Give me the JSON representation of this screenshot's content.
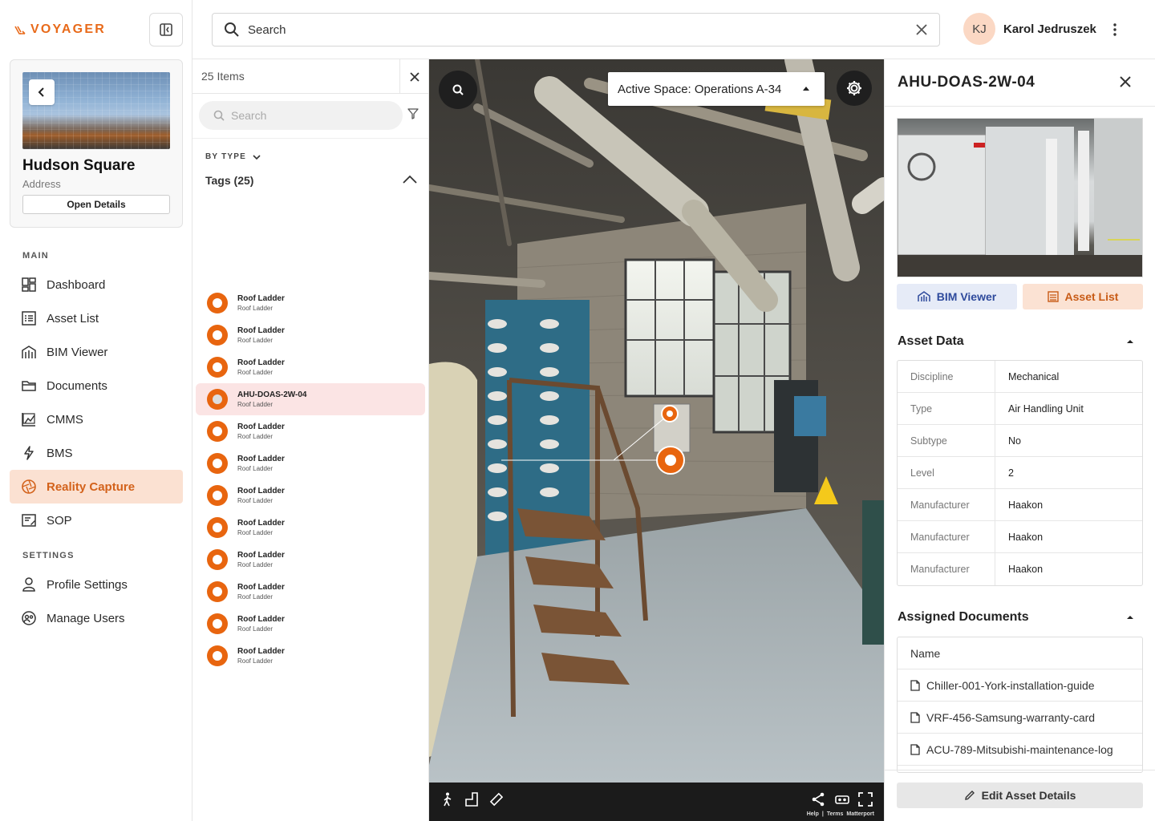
{
  "brand": {
    "name": "VOYAGER",
    "accent": "#e86a1a"
  },
  "property": {
    "name": "Hudson Square",
    "address": "Address",
    "open_details": "Open Details"
  },
  "nav": {
    "main_label": "MAIN",
    "settings_label": "SETTINGS",
    "items": [
      {
        "label": "Dashboard",
        "icon": "dashboard-icon"
      },
      {
        "label": "Asset List",
        "icon": "list-icon"
      },
      {
        "label": "BIM Viewer",
        "icon": "building-icon"
      },
      {
        "label": "Documents",
        "icon": "folder-icon"
      },
      {
        "label": "CMMS",
        "icon": "chart-icon"
      },
      {
        "label": "BMS",
        "icon": "lightning-icon"
      },
      {
        "label": "Reality Capture",
        "icon": "aperture-icon",
        "active": true
      },
      {
        "label": "SOP",
        "icon": "edit-list-icon"
      }
    ],
    "settings_items": [
      {
        "label": "Profile Settings",
        "icon": "user-icon"
      },
      {
        "label": "Manage Users",
        "icon": "users-icon"
      }
    ]
  },
  "search": {
    "placeholder": "Search"
  },
  "user": {
    "initials": "KJ",
    "name": "Karol Jedruszek"
  },
  "tags_panel": {
    "count_label": "25 Items",
    "search_placeholder": "Search",
    "group_by": "BY TYPE",
    "group_title": "Tags (25)",
    "items": [
      {
        "title": "Roof Ladder",
        "subtitle": "Roof Ladder"
      },
      {
        "title": "Roof Ladder",
        "subtitle": "Roof Ladder"
      },
      {
        "title": "Roof Ladder",
        "subtitle": "Roof Ladder"
      },
      {
        "title": "AHU-DOAS-2W-04",
        "subtitle": "Roof Ladder",
        "selected": true
      },
      {
        "title": "Roof Ladder",
        "subtitle": "Roof Ladder"
      },
      {
        "title": "Roof Ladder",
        "subtitle": "Roof Ladder"
      },
      {
        "title": "Roof Ladder",
        "subtitle": "Roof Ladder"
      },
      {
        "title": "Roof Ladder",
        "subtitle": "Roof Ladder"
      },
      {
        "title": "Roof Ladder",
        "subtitle": "Roof Ladder"
      },
      {
        "title": "Roof Ladder",
        "subtitle": "Roof Ladder"
      },
      {
        "title": "Roof Ladder",
        "subtitle": "Roof Ladder"
      },
      {
        "title": "Roof Ladder",
        "subtitle": "Roof Ladder"
      }
    ]
  },
  "viewer": {
    "active_space": "Active Space: Operations A-34",
    "footer_links": [
      "Help",
      "|",
      "Terms",
      "Matterport"
    ]
  },
  "asset": {
    "title": "AHU-DOAS-2W-04",
    "bim_button": "BIM Viewer",
    "asset_list_button": "Asset List",
    "data_title": "Asset Data",
    "data": [
      {
        "key": "Discipline",
        "value": "Mechanical"
      },
      {
        "key": "Type",
        "value": "Air Handling Unit"
      },
      {
        "key": "Subtype",
        "value": "No"
      },
      {
        "key": "Level",
        "value": "2"
      },
      {
        "key": "Manufacturer",
        "value": "Haakon"
      },
      {
        "key": "Manufacturer",
        "value": "Haakon"
      },
      {
        "key": "Manufacturer",
        "value": "Haakon"
      }
    ],
    "docs_title": "Assigned Documents",
    "docs_header": "Name",
    "docs": [
      "Chiller-001-York-installation-guide",
      "VRF-456-Samsung-warranty-card",
      "ACU-789-Mitsubishi-maintenance-log"
    ],
    "edit_button": "Edit Asset Details"
  }
}
